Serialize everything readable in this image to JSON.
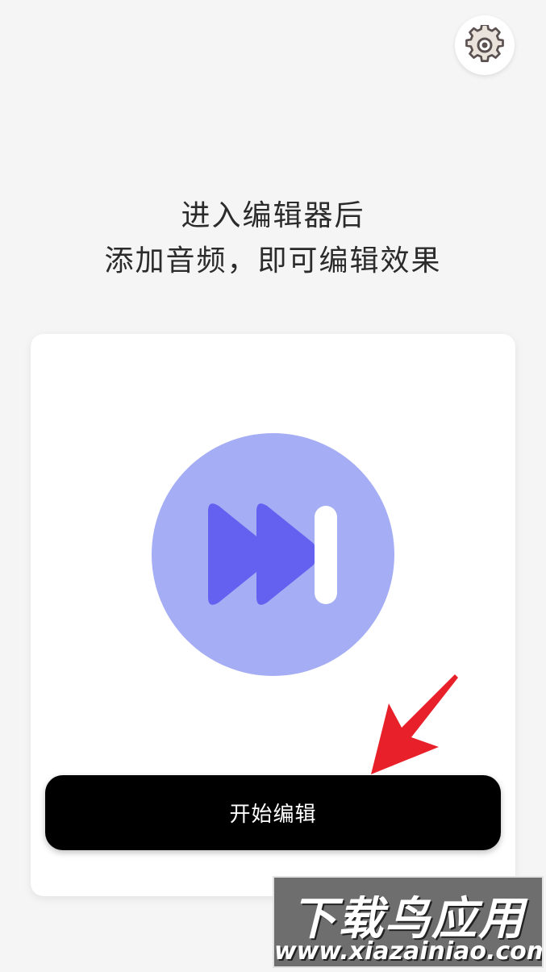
{
  "header": {
    "settings_icon": "gear-icon"
  },
  "hint": {
    "line1": "进入编辑器后",
    "line2": "添加音频，即可编辑效果"
  },
  "card": {
    "logo_icon": "fast-forward-skip-icon",
    "start_button_label": "开始编辑"
  },
  "annotation": {
    "arrow_color": "#e8202a"
  },
  "watermark": {
    "title": "下载鸟应用",
    "url": "www.xiazainiao.com"
  },
  "colors": {
    "background": "#f5f5f5",
    "card": "#ffffff",
    "logo_circle": "#a5adf5",
    "logo_play": "#6461f1",
    "button": "#000000"
  }
}
